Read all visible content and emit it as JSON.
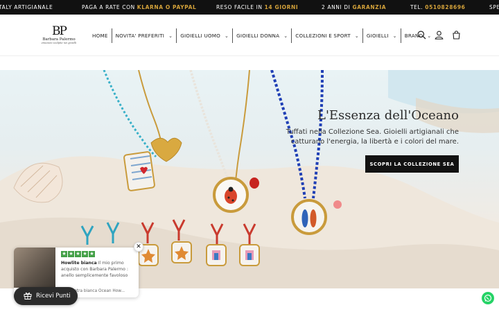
{
  "announcement": {
    "messages": [
      {
        "text": "TALY ARTIGIANALE",
        "highlight": ""
      },
      {
        "text": "PAGA A RATE CON ",
        "highlight": "KLARNA O PAYPAL"
      },
      {
        "text": "RESO FACILE IN ",
        "highlight": "14 GIORNI"
      },
      {
        "text": "2 ANNI DI ",
        "highlight": "GARANZIA"
      },
      {
        "text": "TEL. ",
        "highlight": "0510828696"
      },
      {
        "text": "SPE",
        "highlight": ""
      }
    ]
  },
  "logo": {
    "monogram": "BP",
    "name": "Barbara Palermo",
    "tagline": "emozioni scolpite nei gioielli"
  },
  "nav": {
    "items": [
      {
        "label": "HOME",
        "dropdown": false
      },
      {
        "label": "NOVITA' PREFERITI",
        "dropdown": true
      },
      {
        "label": "GIOIELLI UOMO",
        "dropdown": true
      },
      {
        "label": "GIOIELLI DONNA",
        "dropdown": true
      },
      {
        "label": "COLLEZIONI E SPORT",
        "dropdown": true
      },
      {
        "label": "GIOIELLI",
        "dropdown": true
      },
      {
        "label": "BRAND",
        "dropdown": true
      }
    ]
  },
  "header_icons": [
    "search-icon",
    "account-icon",
    "cart-icon"
  ],
  "hero": {
    "title": "L'Essenza dell'Oceano",
    "subtitle": "Tuffati nella Collezione Sea. Gioielli artigianali che catturano l'energia, la libertà e i colori del mare.",
    "cta": "SCOPRI LA COLLEZIONE SEA"
  },
  "review": {
    "stars": 5,
    "author": "Howlite bianca",
    "text": " Il mio primo acquisto con Barbara Palermo : anello semplicemente favoloso",
    "product": "pietra bianca Ocean How..."
  },
  "rewards": {
    "label": "Ricevi Punti"
  },
  "colors": {
    "accent": "#d4a23a",
    "dark": "#121212",
    "review_star": "#43a047",
    "whatsapp": "#25d366"
  }
}
